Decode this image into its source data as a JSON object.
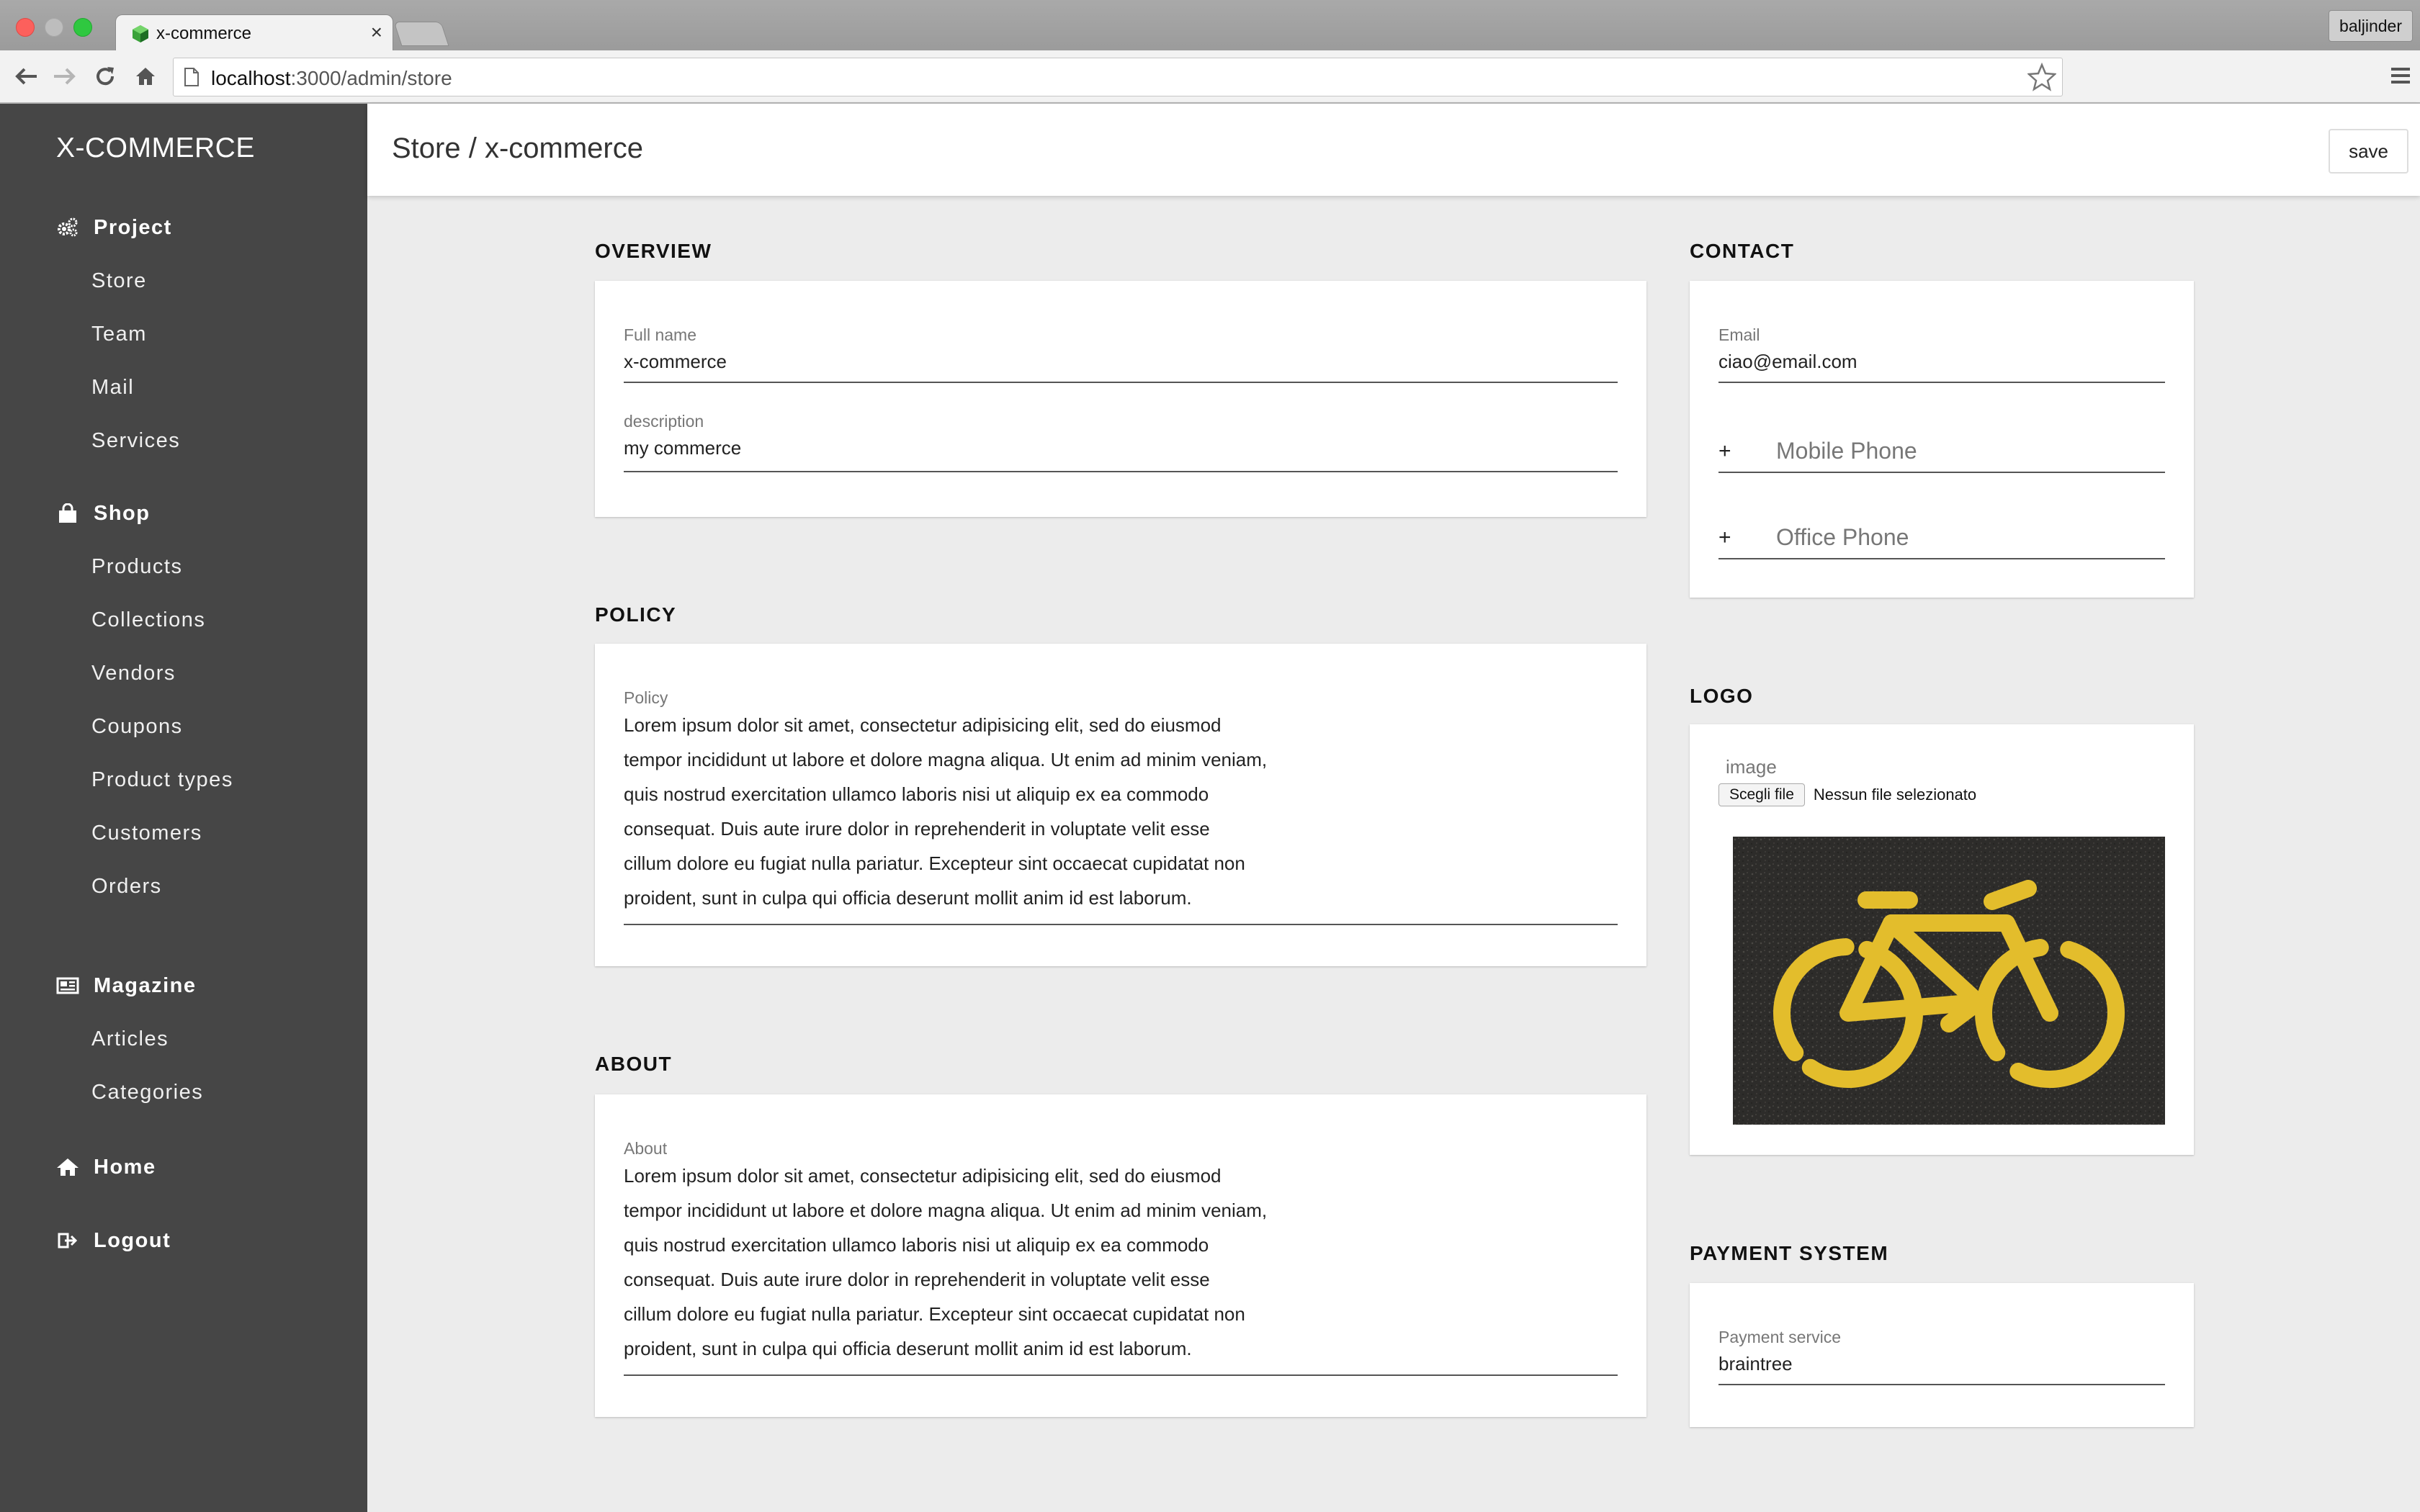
{
  "browser": {
    "tab_title": "x-commerce",
    "profile_name": "baljinder",
    "url_host": "localhost",
    "url_rest": ":3000/admin/store"
  },
  "sidebar": {
    "brand": "X-COMMERCE",
    "groups": [
      {
        "icon": "gears-icon",
        "label": "Project",
        "items": [
          "Store",
          "Team",
          "Mail",
          "Services"
        ]
      },
      {
        "icon": "shopping-bag-icon",
        "label": "Shop",
        "items": [
          "Products",
          "Collections",
          "Vendors",
          "Coupons",
          "Product types",
          "Customers",
          "Orders"
        ]
      },
      {
        "icon": "newspaper-icon",
        "label": "Magazine",
        "items": [
          "Articles",
          "Categories"
        ]
      },
      {
        "icon": "home-icon",
        "label": "Home",
        "items": []
      },
      {
        "icon": "logout-icon",
        "label": "Logout",
        "items": []
      }
    ]
  },
  "header": {
    "title": "Store / x-commerce",
    "save_label": "save"
  },
  "overview": {
    "title": "OVERVIEW",
    "fullname_label": "Full name",
    "fullname_value": "x-commerce",
    "description_label": "description",
    "description_value": "my commerce"
  },
  "policy": {
    "title": "POLICY",
    "label": "Policy",
    "lines": [
      "Lorem ipsum dolor sit amet, consectetur adipisicing elit, sed do eiusmod",
      "tempor incididunt ut labore et dolore magna aliqua. Ut enim ad minim veniam,",
      "quis nostrud exercitation ullamco laboris nisi ut aliquip ex ea commodo",
      "consequat. Duis aute irure dolor in reprehenderit in voluptate velit esse",
      "cillum dolore eu fugiat nulla pariatur. Excepteur sint occaecat cupidatat non",
      "proident, sunt in culpa qui officia deserunt mollit anim id est laborum."
    ]
  },
  "about": {
    "title": "ABOUT",
    "label": "About",
    "lines": [
      "Lorem ipsum dolor sit amet, consectetur adipisicing elit, sed do eiusmod",
      "tempor incididunt ut labore et dolore magna aliqua. Ut enim ad minim veniam,",
      "quis nostrud exercitation ullamco laboris nisi ut aliquip ex ea commodo",
      "consequat. Duis aute irure dolor in reprehenderit in voluptate velit esse",
      "cillum dolore eu fugiat nulla pariatur. Excepteur sint occaecat cupidatat non",
      "proident, sunt in culpa qui officia deserunt mollit anim id est laborum."
    ]
  },
  "contact": {
    "title": "CONTACT",
    "email_label": "Email",
    "email_value": "ciao@email.com",
    "mobile_prefix": "+",
    "mobile_placeholder": "Mobile Phone",
    "office_prefix": "+",
    "office_placeholder": "Office Phone"
  },
  "logo": {
    "title": "LOGO",
    "image_label": "image",
    "choose_label": "Scegli file",
    "file_status": "Nessun file selezionato"
  },
  "payment": {
    "title": "PAYMENT SYSTEM",
    "service_label": "Payment service",
    "service_value": "braintree"
  },
  "colors": {
    "sidebar_bg": "#464646",
    "content_bg": "#ececec",
    "bike_yellow": "#e3bd2c"
  }
}
